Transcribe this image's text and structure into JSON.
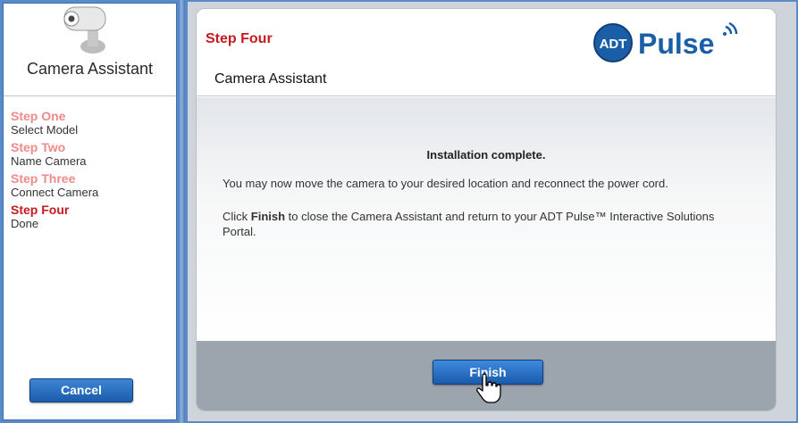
{
  "sidebar": {
    "title": "Camera Assistant",
    "steps": [
      {
        "name": "Step One",
        "sub": "Select Model",
        "active": false
      },
      {
        "name": "Step Two",
        "sub": "Name Camera",
        "active": false
      },
      {
        "name": "Step Three",
        "sub": "Connect Camera",
        "active": false
      },
      {
        "name": "Step Four",
        "sub": "Done",
        "active": true
      }
    ],
    "cancel_label": "Cancel",
    "camera_icon": "camera-icon"
  },
  "header": {
    "step_title": "Step Four",
    "subtitle": "Camera Assistant",
    "logo_badge": "ADT",
    "logo_text": "Pulse"
  },
  "body": {
    "heading": "Installation complete.",
    "line1": "You may now move the camera to your desired location and reconnect the power cord.",
    "line2_pre": "Click ",
    "line2_bold": "Finish",
    "line2_post": " to close the Camera Assistant and return to your ADT Pulse™ Interactive Solutions Portal."
  },
  "footer": {
    "finish_label": "Finish",
    "cursor_icon": "hand-cursor-icon"
  },
  "colors": {
    "active_step": "#c8191e",
    "inactive_step": "#f08a8a",
    "button_blue": "#1c5cab",
    "frame_blue": "#5b8ac8"
  }
}
